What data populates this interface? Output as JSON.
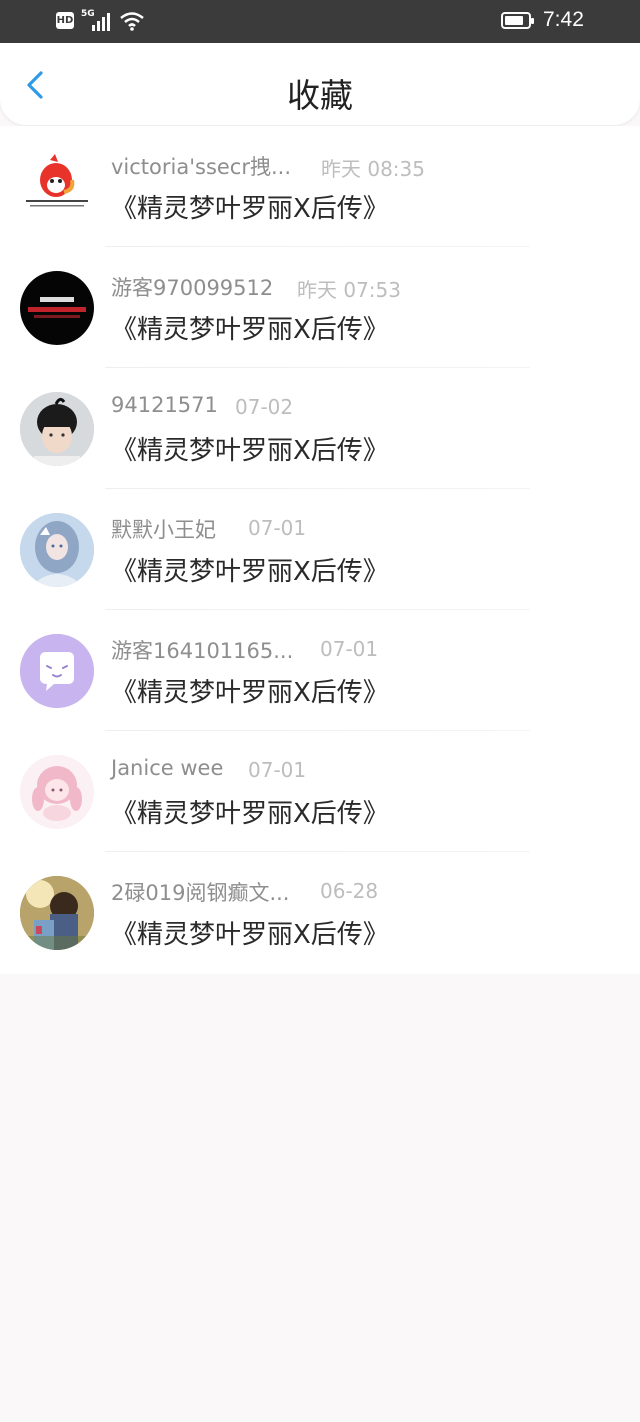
{
  "status_bar": {
    "hd_label": "HD",
    "network_label": "5G",
    "time": "7:42",
    "battery_level": 0.8
  },
  "header": {
    "title": "收藏",
    "back_icon": "chevron-left-icon",
    "accent_color": "#2f9be8"
  },
  "favorites": [
    {
      "username": "victoria'ssecr拽...",
      "time": "昨天 08:35",
      "book_title": "《精灵梦叶罗丽X后传》",
      "avatar": "fox-cartoon"
    },
    {
      "username": "游客970099512",
      "time": "昨天 07:53",
      "book_title": "《精灵梦叶罗丽X后传》",
      "avatar": "black-text-badge"
    },
    {
      "username": "94121571",
      "time": "07-02",
      "book_title": "《精灵梦叶罗丽X后传》",
      "avatar": "boy-photo"
    },
    {
      "username": "默默小王妃",
      "time": "07-01",
      "book_title": "《精灵梦叶罗丽X后传》",
      "avatar": "anime-girl-blue"
    },
    {
      "username": "游客164101165...",
      "time": "07-01",
      "book_title": "《精灵梦叶罗丽X后传》",
      "avatar": "chat-bubble-default"
    },
    {
      "username": "Janice wee",
      "time": "07-01",
      "book_title": "《精灵梦叶罗丽X后传》",
      "avatar": "anime-girl-pink"
    },
    {
      "username": "2碌019阅钢癫文...",
      "time": "06-28",
      "book_title": "《精灵梦叶罗丽X后传》",
      "avatar": "couple-photo"
    }
  ]
}
